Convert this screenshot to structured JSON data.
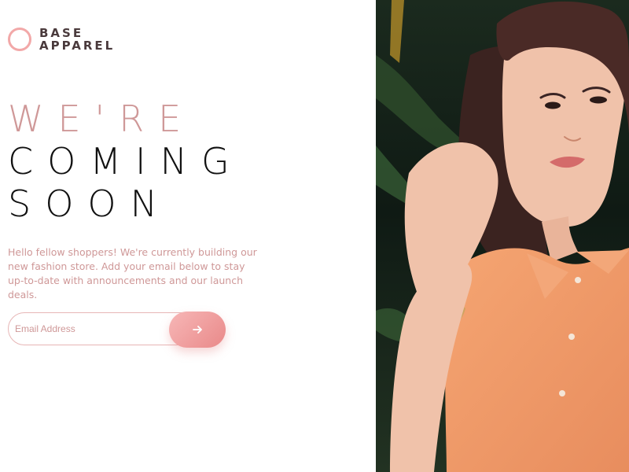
{
  "brand": {
    "line1": "BASE",
    "line2": "APPAREL",
    "accent_color": "#f2a8a8",
    "text_color": "#4a3a3c"
  },
  "hero": {
    "headline_accent": "WE'RE",
    "headline_line2": "COMING",
    "headline_line3": "SOON"
  },
  "intro": {
    "description": "Hello fellow shoppers! We're currently building our new fashion store. Add your email below to stay up-to-date with announcements and our launch deals."
  },
  "signup": {
    "placeholder": "Email Address",
    "value": "",
    "submit_icon": "arrow-right-icon"
  },
  "image": {
    "subject": "hero-model-photo",
    "colors": {
      "background": "#132018",
      "shirt": "#f19a68",
      "hair": "#3b2320",
      "skin": "#f0c2aa"
    }
  }
}
